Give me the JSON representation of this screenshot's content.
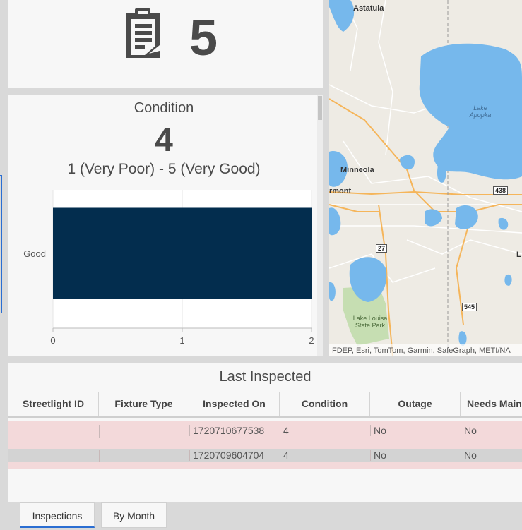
{
  "indicator": {
    "icon": "clipboard-icon",
    "value": "5"
  },
  "condition": {
    "title": "Condition",
    "value": "4",
    "subtitle": "1 (Very Poor) - 5 (Very Good)"
  },
  "chart_data": {
    "type": "bar",
    "orientation": "horizontal",
    "categories": [
      "Good"
    ],
    "values": [
      2
    ],
    "xlim": [
      0,
      2
    ],
    "xticks": [
      "0",
      "1",
      "2"
    ],
    "color": "#032d4e",
    "grid": true
  },
  "map": {
    "labels": [
      "Astatula",
      "Lake Apopka",
      "Minneola",
      "rmont",
      "Lake Louisa State Park",
      "L"
    ],
    "shields": [
      "438",
      "27",
      "545"
    ],
    "attribution": "FDEP, Esri, TomTom, Garmin, SafeGraph, METI/NA"
  },
  "table": {
    "title": "Last Inspected",
    "columns": [
      "Streetlight ID",
      "Fixture Type",
      "Inspected On",
      "Condition",
      "Outage",
      "Needs Main"
    ],
    "rows": [
      [
        "",
        "",
        "1720710677538",
        "4",
        "No",
        "No"
      ],
      [
        "",
        "",
        "1720709604704",
        "4",
        "No",
        "No"
      ]
    ]
  },
  "tabs": [
    {
      "label": "Inspections",
      "active": true
    },
    {
      "label": "By Month",
      "active": false
    }
  ],
  "colors": {
    "bar": "#032d4e",
    "water": "#76b8ec",
    "row_highlight": "#f3d9da",
    "row_selected": "#d3d3d3",
    "tab_accent": "#2a6ed2"
  }
}
